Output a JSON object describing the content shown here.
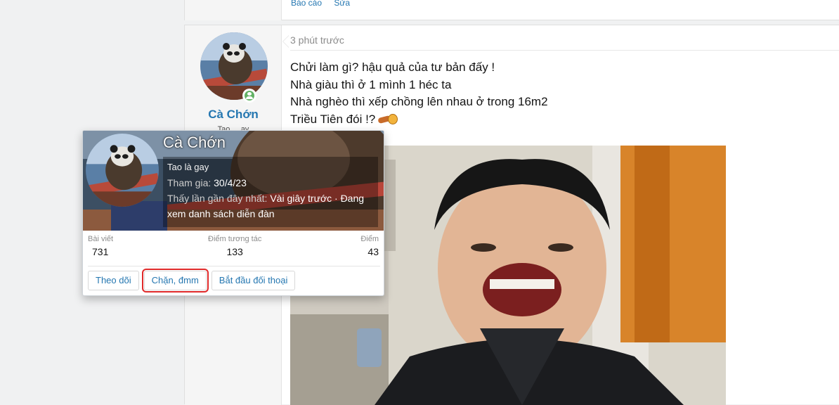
{
  "previous_post": {
    "actions": [
      "Báo cáo",
      "Sửa"
    ]
  },
  "post": {
    "time": "3 phút trước",
    "author": {
      "name": "Cà Chớn",
      "title": "Tao ... ay"
    },
    "lines": [
      "Chửi làm gì? hậu quả của tư bản đấy !",
      "Nhà giàu thì ở 1 mình 1 héc ta",
      "Nhà nghèo thì xếp chồng lên nhau ở trong 16m2",
      "Triều Tiên đói !?"
    ],
    "image": {
      "description": "smiling-man-photo"
    }
  },
  "tooltip": {
    "name": "Cà Chớn",
    "role": "Tao là gay",
    "joined_label": "Tham gia:",
    "joined_value": "30/4/23",
    "last_seen_label": "Thấy lần gần đây nhất:",
    "last_seen_value": "Vài giây trước · Đang xem danh sách diễn đàn",
    "stats": [
      {
        "label": "Bài viết",
        "value": "731"
      },
      {
        "label": "Điểm tương tác",
        "value": "133"
      },
      {
        "label": "Điểm",
        "value": "43"
      }
    ],
    "buttons": {
      "follow": "Theo dõi",
      "block": "Chặn, đmm",
      "conversation": "Bắt đầu đối thoại"
    }
  },
  "colors": {
    "link": "#2577b1",
    "highlight_border": "#e02a2a",
    "online": "#63b265"
  }
}
